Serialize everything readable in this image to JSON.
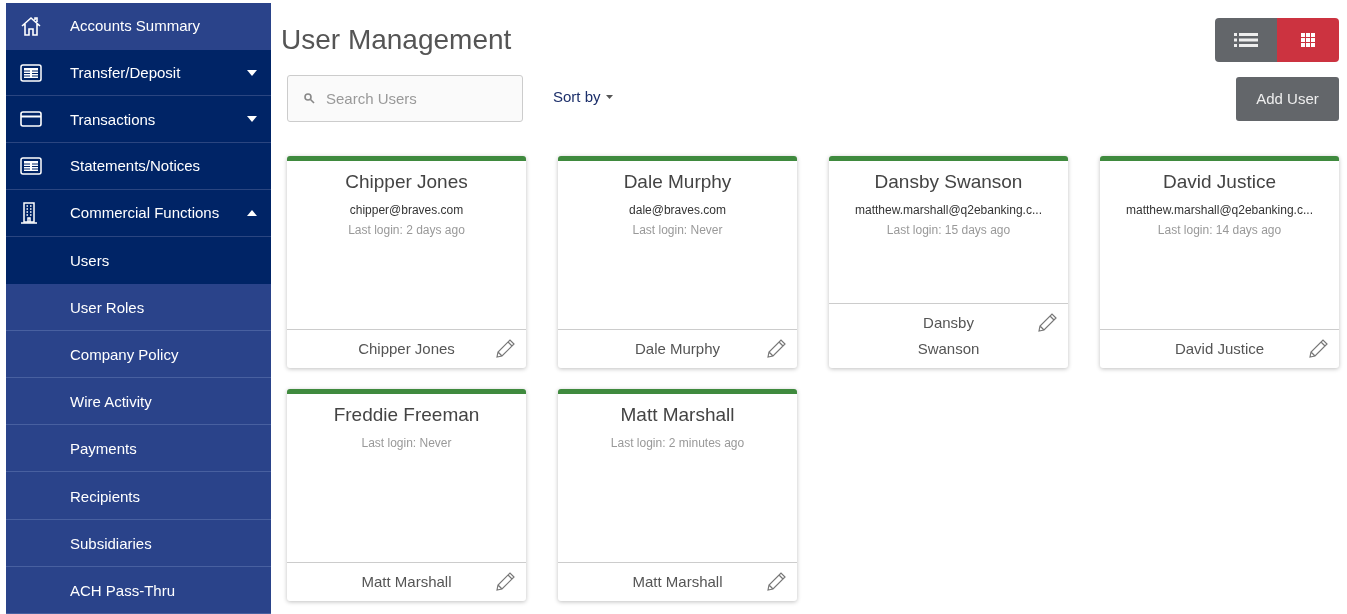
{
  "sidebar": {
    "items": [
      {
        "label": "Accounts Summary",
        "highlighted": true
      },
      {
        "label": "Transfer/Deposit",
        "highlighted": false,
        "expanded": false
      },
      {
        "label": "Transactions",
        "highlighted": false,
        "expanded": false
      },
      {
        "label": "Statements/Notices",
        "highlighted": false
      },
      {
        "label": "Commercial Functions",
        "highlighted": false,
        "expanded": true,
        "children": [
          {
            "label": "Users",
            "selected": true
          },
          {
            "label": "User Roles",
            "selected": false
          },
          {
            "label": "Company Policy",
            "selected": false
          },
          {
            "label": "Wire Activity",
            "selected": false
          },
          {
            "label": "Payments",
            "selected": false
          },
          {
            "label": "Recipients",
            "selected": false
          },
          {
            "label": "Subsidiaries",
            "selected": false
          },
          {
            "label": "ACH Pass-Thru",
            "selected": false
          }
        ]
      }
    ]
  },
  "page": {
    "title": "User Management"
  },
  "view_toggle": [
    {
      "kind": "list",
      "selected": false
    },
    {
      "kind": "grid",
      "selected": true
    }
  ],
  "search": {
    "placeholder": "Search Users"
  },
  "sort": {
    "label": "Sort by"
  },
  "add_button": "Add User",
  "cards": [
    {
      "name": "Chipper Jones",
      "email": "chipper@braves.com",
      "last_login": "Last login: 2 days ago",
      "footer_name": "Chipper Jones"
    },
    {
      "name": "Dale Murphy",
      "email": "dale@braves.com",
      "last_login": "Last login: Never",
      "footer_name": "Dale Murphy"
    },
    {
      "name": "Dansby Swanson",
      "email": "matthew.marshall@q2ebanking.c...",
      "last_login": "Last login: 15 days ago",
      "footer_name": "Dansby Swanson"
    },
    {
      "name": "David Justice",
      "email": "matthew.marshall@q2ebanking.c...",
      "last_login": "Last login: 14 days ago",
      "footer_name": "David Justice"
    },
    {
      "name": "Freddie Freeman",
      "last_login": "Last login: Never",
      "footer_name": "Matt Marshall"
    },
    {
      "name": "Matt Marshall",
      "last_login": "Last login: 2 minutes ago",
      "footer_name": "Matt Marshall"
    }
  ]
}
